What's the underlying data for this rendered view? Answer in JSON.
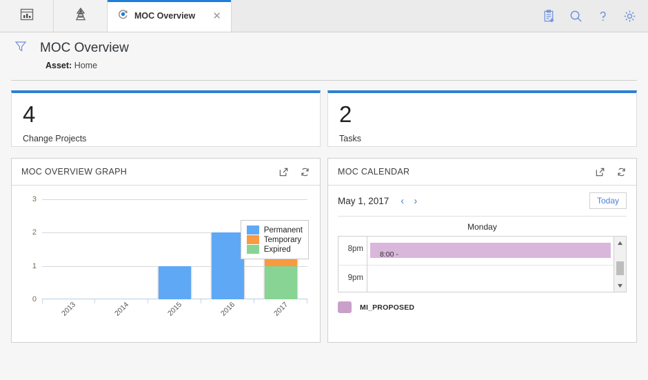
{
  "tabbar": {
    "icons": [
      {
        "name": "dashboard-icon",
        "label": "Dashboard"
      },
      {
        "name": "hierarchy-icon",
        "label": "Hierarchy"
      }
    ],
    "active_tab": {
      "label": "MOC Overview",
      "icon": "moc-cycle-icon",
      "close": "✕"
    },
    "actions": [
      {
        "name": "new-record-icon",
        "label": "New"
      },
      {
        "name": "search-icon",
        "label": "Search"
      },
      {
        "name": "help-icon",
        "label": "Help"
      },
      {
        "name": "settings-icon",
        "label": "Settings"
      }
    ]
  },
  "page": {
    "title": "MOC Overview",
    "filter_icon": "filter-funnel-icon",
    "asset_label": "Asset:",
    "asset_value": "Home"
  },
  "kpis": [
    {
      "value": "4",
      "label": "Change Projects",
      "accent": "#2f7fd1"
    },
    {
      "value": "2",
      "label": "Tasks",
      "accent": "#2f7fd1"
    }
  ],
  "graph_panel": {
    "title": "MOC OVERVIEW GRAPH",
    "icons": [
      {
        "name": "open-external-icon",
        "label": "Open in new window"
      },
      {
        "name": "refresh-icon",
        "label": "Refresh"
      }
    ]
  },
  "calendar_panel": {
    "title": "MOC CALENDAR",
    "icons": [
      {
        "name": "open-external-icon",
        "label": "Open in new window"
      },
      {
        "name": "refresh-icon",
        "label": "Refresh"
      }
    ],
    "current_date": "May 1, 2017",
    "prev_label": "‹",
    "next_label": "›",
    "today_label": "Today",
    "day_header": "Monday",
    "hours": [
      "8pm",
      "9pm"
    ],
    "events": [
      {
        "text": "8:00 -",
        "color": "#d9b7da"
      }
    ],
    "legend": [
      {
        "label": "MI_PROPOSED",
        "color": "#c9a0ca"
      }
    ]
  },
  "chart_data": {
    "type": "bar",
    "stacked": true,
    "title": "MOC OVERVIEW GRAPH",
    "xlabel": "",
    "ylabel": "",
    "categories": [
      "2013",
      "2014",
      "2015",
      "2016",
      "2017"
    ],
    "ylim": [
      0,
      3
    ],
    "yticks": [
      "0",
      "1",
      "2",
      "3"
    ],
    "grid": true,
    "legend_position": "right",
    "series": [
      {
        "name": "Permanent",
        "color": "#5fa8f5",
        "values": [
          0,
          0,
          1,
          2,
          0
        ]
      },
      {
        "name": "Temporary",
        "color": "#f89a3f",
        "values": [
          0,
          0,
          0,
          0,
          1
        ]
      },
      {
        "name": "Expired",
        "color": "#87d494",
        "values": [
          0,
          0,
          0,
          0,
          1
        ]
      }
    ]
  }
}
